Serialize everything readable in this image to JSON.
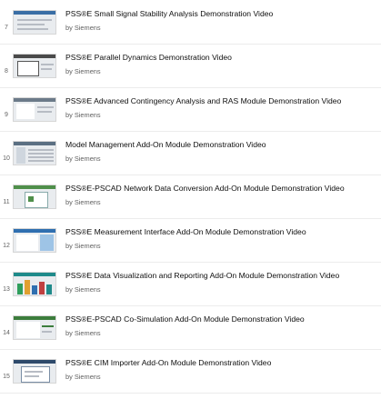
{
  "playlist": {
    "items": [
      {
        "index": "7",
        "title": "PSS®E Small Signal Stability Analysis Demonstration Video",
        "channel": "by Siemens",
        "thumb_color": "#3a6ea5"
      },
      {
        "index": "8",
        "title": "PSS®E Parallel Dynamics Demonstration Video",
        "channel": "by Siemens",
        "thumb_color": "#4a4a4a"
      },
      {
        "index": "9",
        "title": "PSS®E Advanced Contingency Analysis and RAS Module Demonstration Video",
        "channel": "by Siemens",
        "thumb_color": "#6c7a89"
      },
      {
        "index": "10",
        "title": "Model Management Add-On Module Demonstration Video",
        "channel": "by Siemens",
        "thumb_color": "#5b6f82"
      },
      {
        "index": "11",
        "title": "PSS®E-PSCAD Network Data Conversion Add-On Module Demonstration Video",
        "channel": "by Siemens",
        "thumb_color": "#4f8f4a"
      },
      {
        "index": "12",
        "title": "PSS®E Measurement Interface Add-On Module Demonstration Video",
        "channel": "by Siemens",
        "thumb_color": "#2f6fb0"
      },
      {
        "index": "13",
        "title": "PSS®E Data Visualization and Reporting Add-On Module Demonstration Video",
        "channel": "by Siemens",
        "thumb_color": "#1f8a8a"
      },
      {
        "index": "14",
        "title": "PSS®E-PSCAD Co-Simulation Add-On Module Demonstration Video",
        "channel": "by Siemens",
        "thumb_color": "#3c7d3c"
      },
      {
        "index": "15",
        "title": "PSS®E CIM Importer Add-On Module Demonstration Video",
        "channel": "by Siemens",
        "thumb_color": "#2e4a6b"
      }
    ]
  }
}
